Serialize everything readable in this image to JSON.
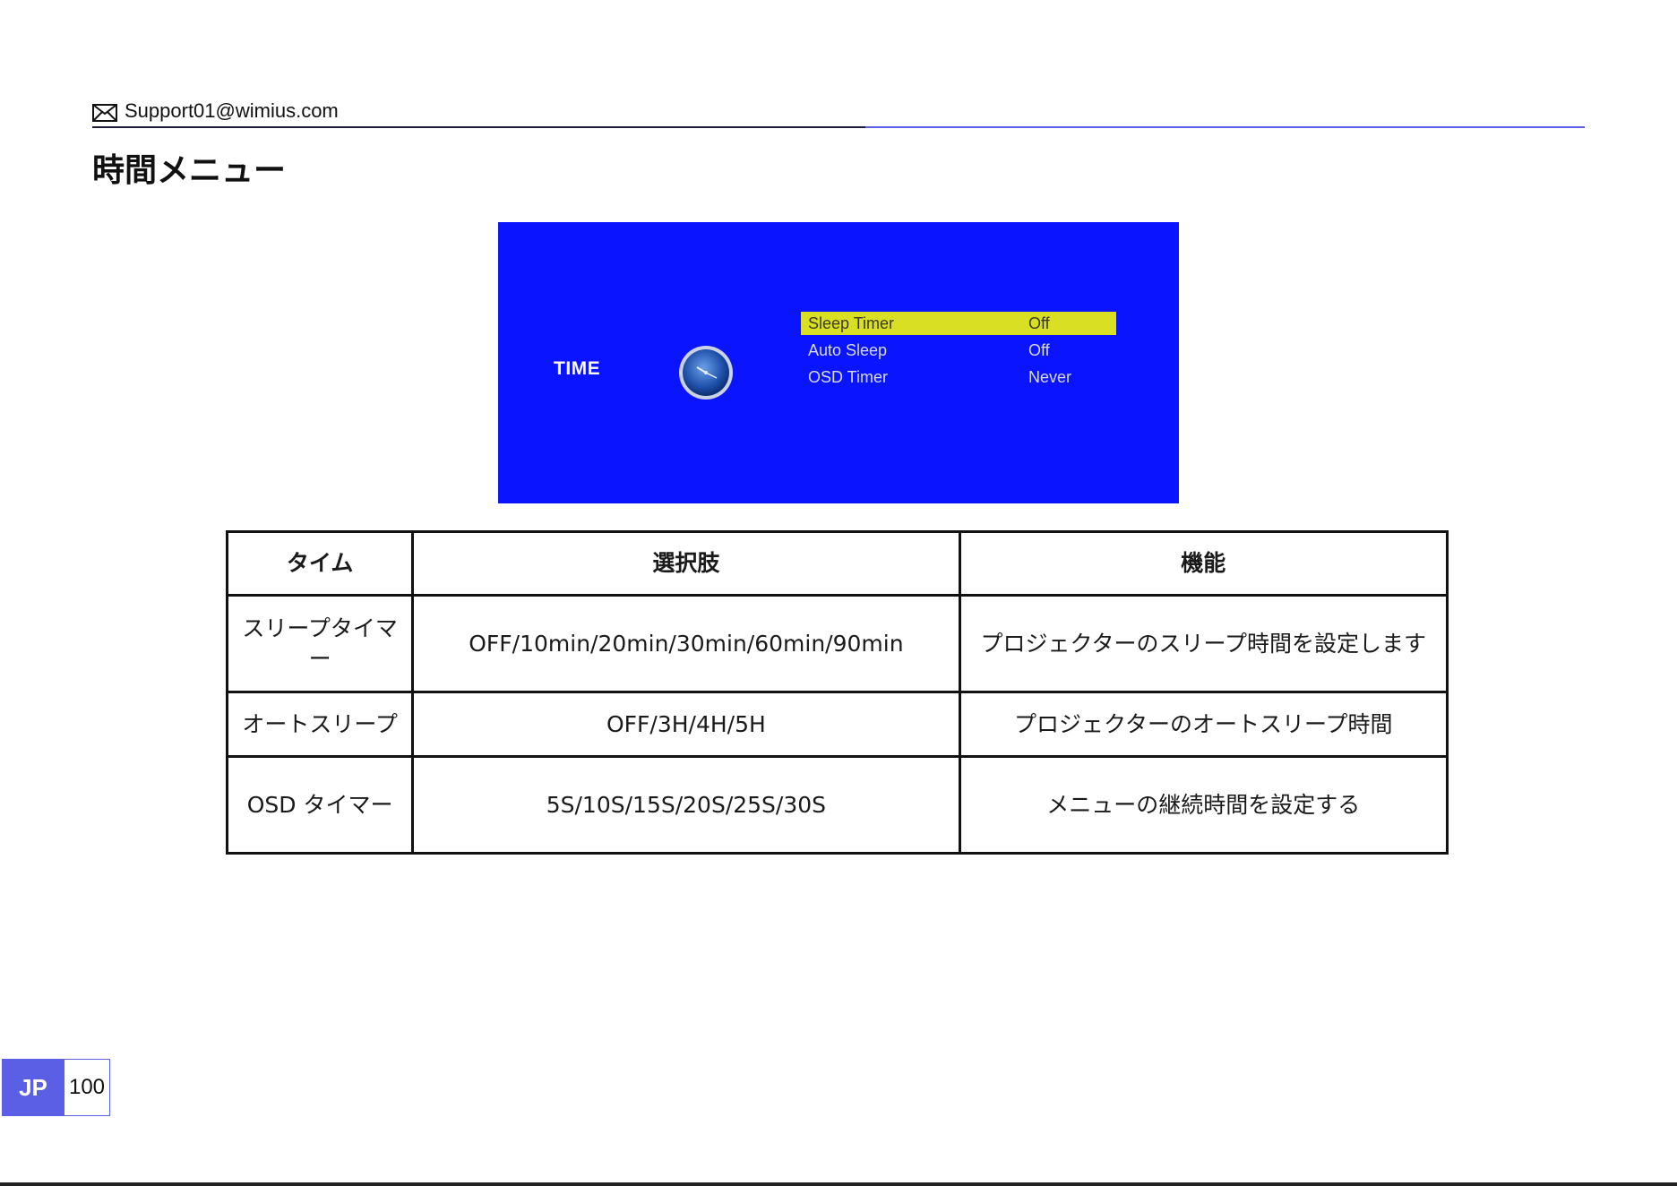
{
  "header": {
    "email": "Support01@wimius.com",
    "icon": "mail-icon"
  },
  "page_title": "時間メニュー",
  "osd": {
    "category": "TIME",
    "icon": "clock-icon",
    "items": [
      {
        "label": "Sleep Timer",
        "value": "Off",
        "selected": true
      },
      {
        "label": "Auto Sleep",
        "value": "Off",
        "selected": false
      },
      {
        "label": "OSD Timer",
        "value": "Never",
        "selected": false
      }
    ],
    "colors": {
      "background": "#0a14ff",
      "highlight": "#d9e024"
    }
  },
  "table": {
    "headers": [
      "タイム",
      "選択肢",
      "機能"
    ],
    "rows": [
      [
        "スリープタイマー",
        "OFF/10min/20min/30min/60min/90min",
        "プロジェクターのスリープ時間を設定します"
      ],
      [
        "オートスリープ",
        "OFF/3H/4H/5H",
        "プロジェクターのオートスリープ時間"
      ],
      [
        "OSD タイマー",
        "5S/10S/15S/20S/25S/30S",
        "メニューの継続時間を設定する"
      ]
    ]
  },
  "footer": {
    "language": "JP",
    "page_number": "100",
    "accent_color": "#5b5fe6"
  }
}
